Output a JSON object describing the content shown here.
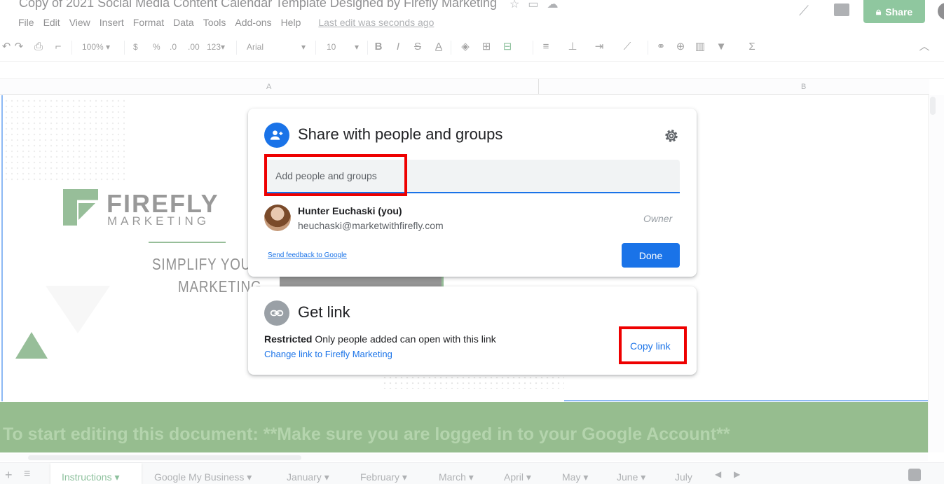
{
  "document": {
    "title": "Copy of 2021 Social Media Content Calendar Template Designed by Firefly Marketing",
    "share_label": "Share",
    "last_edit": "Last edit was seconds ago"
  },
  "menu": [
    "File",
    "Edit",
    "View",
    "Insert",
    "Format",
    "Data",
    "Tools",
    "Add-ons",
    "Help"
  ],
  "toolbar": {
    "zoom": "100%",
    "currency": "$",
    "percent": "%",
    "decimal_less": ".0",
    "decimal_more": ".00",
    "format_more": "123",
    "font": "Arial",
    "font_size": "10"
  },
  "columns": [
    "A",
    "B"
  ],
  "sheet": {
    "logo_word": "FIREFLY",
    "logo_sub": "MARKETING",
    "tagline_1": "SIMPLIFY YOU",
    "tagline_2": "MARKETING",
    "banner": "To start editing this document: **Make sure you are logged in to your Google Account**"
  },
  "tabs": [
    "Instructions",
    "Google My Business",
    "January",
    "February",
    "March",
    "April",
    "May",
    "June",
    "July"
  ],
  "share_dialog": {
    "title": "Share with people and groups",
    "input_placeholder": "Add people and groups",
    "user_name": "Hunter Euchaski (you)",
    "user_email": "heuchaski@marketwithfirefly.com",
    "user_role": "Owner",
    "feedback": "Send feedback to Google",
    "done": "Done"
  },
  "link_dialog": {
    "title": "Get link",
    "restricted_bold": "Restricted",
    "restricted_text": " Only people added can open with this link",
    "change_link": "Change link to Firefly Marketing",
    "copy_link": "Copy link"
  },
  "colors": {
    "accent": "#1a73e8",
    "share_green": "#1e8e3e",
    "highlight": "#ee0000",
    "banner_green": "#2d7a1f"
  }
}
